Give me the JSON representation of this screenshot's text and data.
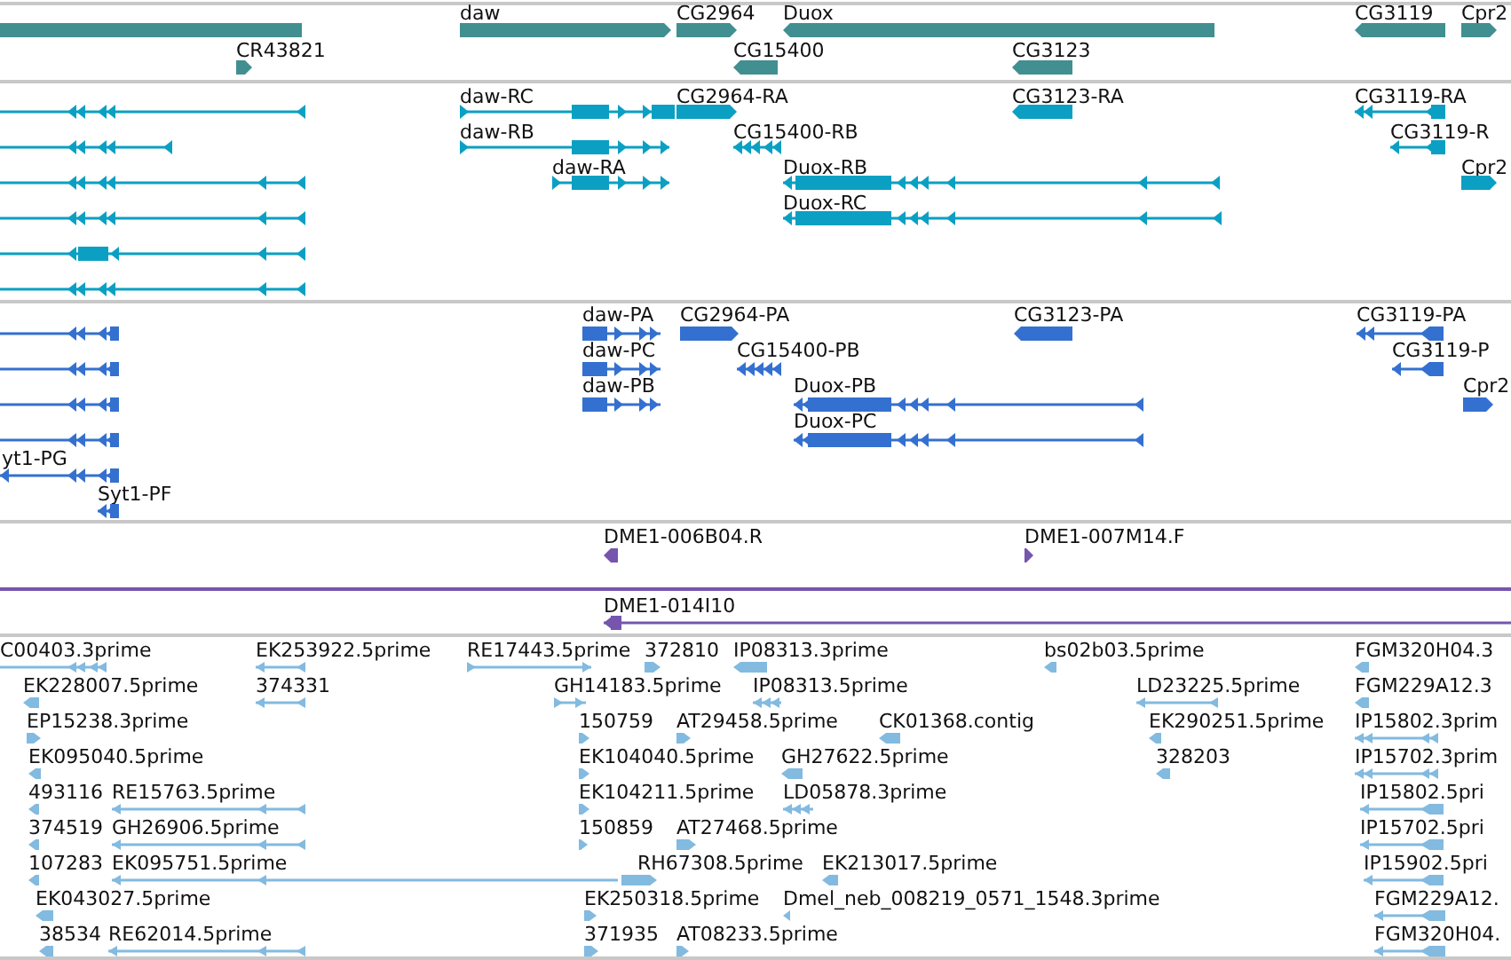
{
  "tracks": [
    {
      "color": "#418f91",
      "features": [
        {
          "kind": "block"
        },
        {
          "label": "daw",
          "kind": "block",
          "reverse": false
        },
        {
          "label": "CG2964",
          "kind": "block",
          "reverse": false
        },
        {
          "label": "Duox",
          "kind": "block",
          "reverse": true
        },
        {
          "label": "CG3119",
          "kind": "block",
          "reverse": true
        },
        {
          "label": "Cpr2",
          "kind": "block",
          "reverse": false
        },
        {
          "label": "CR43821",
          "kind": "block",
          "reverse": false
        },
        {
          "label": "CG15400",
          "kind": "block",
          "reverse": true
        },
        {
          "label": "CG3123",
          "kind": "block",
          "reverse": true
        }
      ]
    },
    {
      "color": "#0ba0c3",
      "features": [
        {
          "kind": "spliced",
          "reverse": true
        },
        {
          "kind": "spliced",
          "reverse": true
        },
        {
          "kind": "spliced",
          "reverse": true
        },
        {
          "kind": "spliced",
          "reverse": true
        },
        {
          "kind": "spliced",
          "reverse": true
        },
        {
          "kind": "spliced",
          "reverse": true
        },
        {
          "label": "daw-RC",
          "kind": "spliced",
          "reverse": false
        },
        {
          "label": "CG2964-RA",
          "kind": "block",
          "reverse": false
        },
        {
          "label": "CG3123-RA",
          "kind": "block",
          "reverse": true
        },
        {
          "label": "CG3119-RA",
          "kind": "spliced",
          "reverse": true
        },
        {
          "label": "daw-RB",
          "kind": "spliced",
          "reverse": false
        },
        {
          "label": "CG15400-RB",
          "kind": "spliced",
          "reverse": true
        },
        {
          "label": "CG3119-R",
          "kind": "spliced",
          "reverse": true
        },
        {
          "label": "daw-RA",
          "kind": "spliced",
          "reverse": false
        },
        {
          "label": "Duox-RB",
          "kind": "spliced",
          "reverse": true
        },
        {
          "label": "Cpr2",
          "kind": "block",
          "reverse": false
        },
        {
          "label": "Duox-RC",
          "kind": "spliced",
          "reverse": true
        }
      ]
    },
    {
      "color": "#3470cf",
      "features": [
        {
          "kind": "spliced",
          "reverse": true
        },
        {
          "kind": "spliced",
          "reverse": true
        },
        {
          "kind": "spliced",
          "reverse": true
        },
        {
          "kind": "spliced",
          "reverse": true
        },
        {
          "label": "yt1-PG",
          "kind": "spliced",
          "reverse": true
        },
        {
          "label": "Syt1-PF",
          "kind": "spliced",
          "reverse": true
        },
        {
          "label": "daw-PA",
          "kind": "spliced",
          "reverse": false
        },
        {
          "label": "CG2964-PA",
          "kind": "block",
          "reverse": false
        },
        {
          "label": "CG3123-PA",
          "kind": "block",
          "reverse": true
        },
        {
          "label": "CG3119-PA",
          "kind": "spliced",
          "reverse": true
        },
        {
          "label": "daw-PC",
          "kind": "spliced",
          "reverse": false
        },
        {
          "label": "CG15400-PB",
          "kind": "spliced",
          "reverse": true
        },
        {
          "label": "CG3119-P",
          "kind": "spliced",
          "reverse": true
        },
        {
          "label": "daw-PB",
          "kind": "spliced",
          "reverse": false
        },
        {
          "label": "Duox-PB",
          "kind": "spliced",
          "reverse": true
        },
        {
          "label": "Cpr2",
          "kind": "block",
          "reverse": false
        },
        {
          "label": "Duox-PC",
          "kind": "spliced",
          "reverse": true
        }
      ]
    },
    {
      "color": "#7555ad",
      "features": [
        {
          "label": "DME1-006B04.R",
          "kind": "block",
          "reverse": true
        },
        {
          "label": "DME1-007M14.F",
          "kind": "block",
          "reverse": false
        },
        {
          "kind": "plain"
        },
        {
          "label": "DME1-014I10",
          "kind": "spliced",
          "reverse": true
        }
      ]
    },
    {
      "color": "#82bae0",
      "features": [
        {
          "label": "C00403.3prime",
          "kind": "spliced",
          "reverse": true
        },
        {
          "label": "EK253922.5prime",
          "kind": "spliced",
          "reverse": true
        },
        {
          "label": "RE17443.5prime",
          "kind": "spliced",
          "reverse": false
        },
        {
          "label": "372810",
          "kind": "block",
          "reverse": false
        },
        {
          "label": "IP08313.3prime",
          "kind": "block",
          "reverse": true
        },
        {
          "label": "bs02b03.5prime",
          "kind": "block",
          "reverse": true
        },
        {
          "label": "FGM320H04.3",
          "kind": "block",
          "reverse": true
        },
        {
          "label": "EK228007.5prime",
          "kind": "block",
          "reverse": true
        },
        {
          "label": "374331",
          "kind": "spliced",
          "reverse": true
        },
        {
          "label": "GH14183.5prime",
          "kind": "spliced",
          "reverse": false
        },
        {
          "label": "IP08313.5prime",
          "kind": "spliced",
          "reverse": true
        },
        {
          "label": "LD23225.5prime",
          "kind": "spliced",
          "reverse": true
        },
        {
          "label": "FGM229A12.3",
          "kind": "block",
          "reverse": true
        },
        {
          "label": "EP15238.3prime",
          "kind": "block",
          "reverse": false
        },
        {
          "label": "150759",
          "kind": "block",
          "reverse": false
        },
        {
          "label": "AT29458.5prime",
          "kind": "block",
          "reverse": false
        },
        {
          "label": "CK01368.contig",
          "kind": "block",
          "reverse": true
        },
        {
          "label": "EK290251.5prime",
          "kind": "block",
          "reverse": true
        },
        {
          "label": "IP15802.3prim",
          "kind": "spliced",
          "reverse": true
        },
        {
          "label": "EK095040.5prime",
          "kind": "block",
          "reverse": true
        },
        {
          "label": "EK104040.5prime",
          "kind": "block",
          "reverse": false
        },
        {
          "label": "GH27622.5prime",
          "kind": "block",
          "reverse": true
        },
        {
          "label": "328203",
          "kind": "block",
          "reverse": true
        },
        {
          "label": "IP15702.3prim",
          "kind": "spliced",
          "reverse": true
        },
        {
          "label": "493116",
          "kind": "block",
          "reverse": true
        },
        {
          "label": "RE15763.5prime",
          "kind": "spliced",
          "reverse": true
        },
        {
          "label": "EK104211.5prime",
          "kind": "block",
          "reverse": false
        },
        {
          "label": "LD05878.3prime",
          "kind": "spliced",
          "reverse": true
        },
        {
          "label": "IP15802.5pri",
          "kind": "spliced",
          "reverse": true
        },
        {
          "label": "374519",
          "kind": "block",
          "reverse": true
        },
        {
          "label": "GH26906.5prime",
          "kind": "spliced",
          "reverse": true
        },
        {
          "label": "150859",
          "kind": "block",
          "reverse": false
        },
        {
          "label": "AT27468.5prime",
          "kind": "block",
          "reverse": false
        },
        {
          "label": "IP15702.5pri",
          "kind": "spliced",
          "reverse": true
        },
        {
          "label": "107283",
          "kind": "block",
          "reverse": true
        },
        {
          "label": "EK095751.5prime",
          "kind": "spliced",
          "reverse": true
        },
        {
          "label": "RH67308.5prime",
          "kind": "block",
          "reverse": false
        },
        {
          "label": "EK213017.5prime",
          "kind": "block",
          "reverse": true
        },
        {
          "label": "IP15902.5pri",
          "kind": "spliced",
          "reverse": true
        },
        {
          "label": "EK043027.5prime",
          "kind": "block",
          "reverse": true
        },
        {
          "label": "EK250318.5prime",
          "kind": "block",
          "reverse": false
        },
        {
          "label": "Dmel_neb_008219_0571_1548.3prime",
          "kind": "block",
          "reverse": true
        },
        {
          "label": "FGM229A12.",
          "kind": "spliced",
          "reverse": true
        },
        {
          "label": "38534",
          "kind": "block",
          "reverse": true
        },
        {
          "label": "RE62014.5prime",
          "kind": "spliced",
          "reverse": true
        },
        {
          "label": "371935",
          "kind": "block",
          "reverse": false
        },
        {
          "label": "AT08233.5prime",
          "kind": "block",
          "reverse": false
        },
        {
          "label": "FGM320H04.",
          "kind": "spliced",
          "reverse": true
        }
      ]
    }
  ]
}
